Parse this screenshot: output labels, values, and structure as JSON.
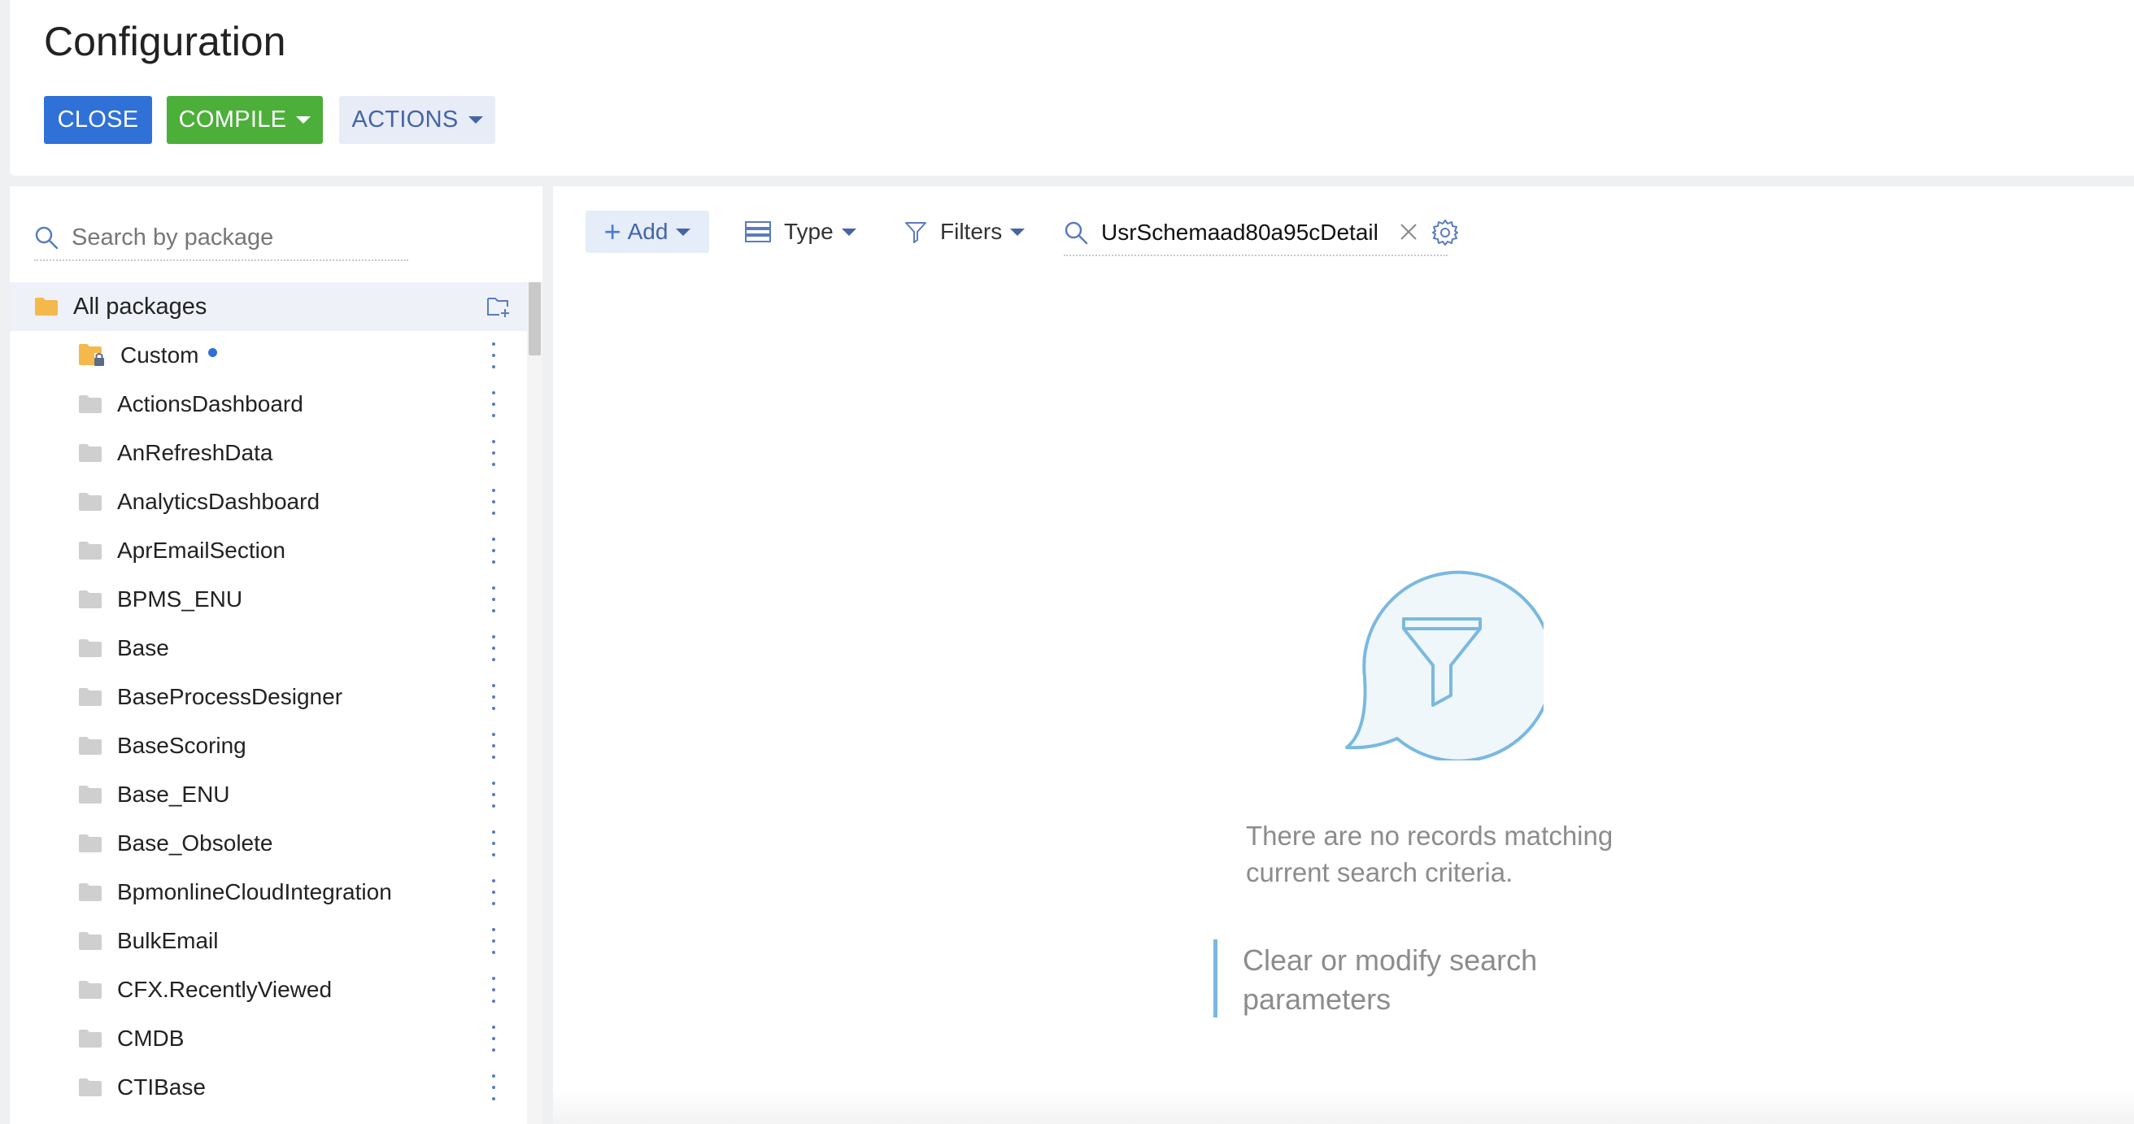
{
  "header": {
    "title": "Configuration",
    "close_label": "CLOSE",
    "compile_label": "COMPILE",
    "actions_label": "ACTIONS"
  },
  "sidebar": {
    "search_placeholder": "Search by package",
    "all_packages_label": "All packages",
    "packages": [
      {
        "label": "Custom"
      },
      {
        "label": "ActionsDashboard"
      },
      {
        "label": "AnRefreshData"
      },
      {
        "label": "AnalyticsDashboard"
      },
      {
        "label": "AprEmailSection"
      },
      {
        "label": "BPMS_ENU"
      },
      {
        "label": "Base"
      },
      {
        "label": "BaseProcessDesigner"
      },
      {
        "label": "BaseScoring"
      },
      {
        "label": "Base_ENU"
      },
      {
        "label": "Base_Obsolete"
      },
      {
        "label": "BpmonlineCloudIntegration"
      },
      {
        "label": "BulkEmail"
      },
      {
        "label": "CFX.RecentlyViewed"
      },
      {
        "label": "CMDB"
      },
      {
        "label": "CTIBase"
      }
    ]
  },
  "toolbar": {
    "add_label": "Add",
    "type_label": "Type",
    "filters_label": "Filters",
    "search_value": "UsrSchemaad80a95cDetail"
  },
  "empty_state": {
    "message": "There are no records matching current search criteria.",
    "hint": "Clear or modify search parameters"
  },
  "colors": {
    "close_button": "#2f71d6",
    "compile_button": "#4caf3a",
    "actions_button_bg": "#e8ecf6",
    "accent_text": "#4464a6",
    "folder_yellow": "#f5b84a",
    "folder_grey": "#cfcfcf",
    "hint_bar": "#7ab8e0"
  }
}
